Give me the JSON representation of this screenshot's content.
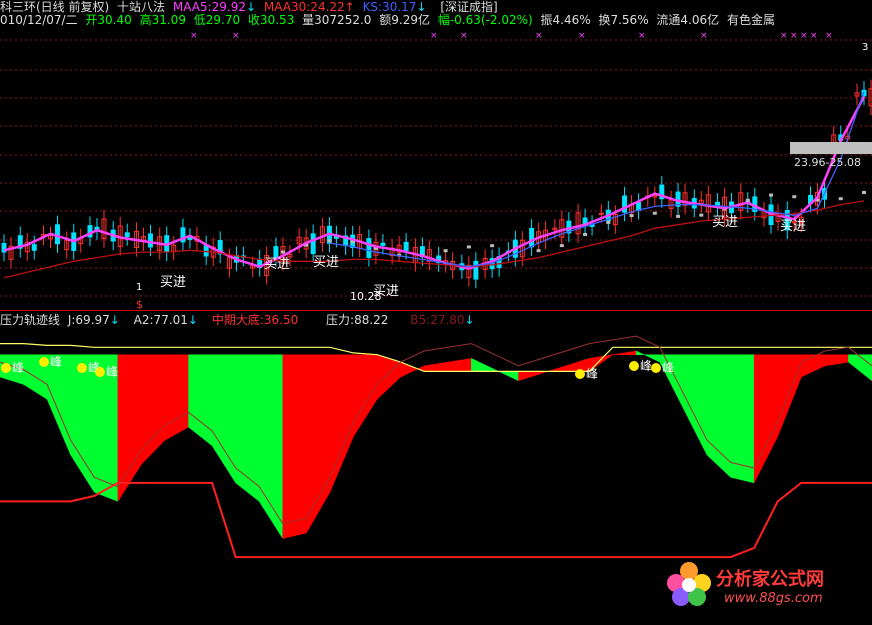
{
  "header": {
    "line1": {
      "title": "科三环(日线 前复权)",
      "method": "十站八法",
      "maa5": {
        "text": "MAA5:29.92",
        "color": "#ff40ff"
      },
      "maa5_arrow": "↓",
      "maa30": {
        "text": "MAA30:24.22",
        "color": "#ff3030"
      },
      "maa30_arrow": "↑",
      "ks": {
        "text": "KS:30.17",
        "color": "#4060ff"
      },
      "ks_arrow": "↓",
      "index": "[深证成指]"
    },
    "line2": {
      "date": "010/12/07/二",
      "open": "开30.40",
      "high": "高31.09",
      "low": "低29.70",
      "close": "收30.53",
      "volume": "量307252.0",
      "amount": "额9.29亿",
      "change": "幅-0.63(-2.02%)",
      "amplitude": "振4.46%",
      "turnover": "换7.56%",
      "float": "流通4.06亿",
      "sector": "有色金属"
    }
  },
  "indicator_header": {
    "name": "压力轨迹线",
    "j": "J:69.97",
    "j_arrow": "↓",
    "a2": "A2:77.01",
    "a2_arrow": "↓",
    "zhongqi": "中期大底:36.50",
    "yali": "压力:88.22",
    "b5": "B5:27.80",
    "b5_arrow": "↓"
  },
  "annotations": {
    "buy": "买进",
    "peak": "峰",
    "range": "23.96-25.08",
    "low_price": "10.28",
    "dollar": "$",
    "s1": "1",
    "s3": "3"
  },
  "watermark": {
    "title": "分析家公式网",
    "url": "www.88gs.com"
  },
  "colors": {
    "up": "#ff3030",
    "down": "#00e0ff",
    "maa5": "#ff40ff",
    "ks": "#4060ff",
    "maa30": "#c01010",
    "grey_series": "#bbbbbb",
    "red_fill": "#ff0000",
    "green_fill": "#00ff30",
    "yellow": "#ffff66",
    "grid": "#8b1a1a"
  },
  "chart_data": [
    {
      "type": "line",
      "panel": "price",
      "series": [
        {
          "name": "MAA5",
          "values": [
            21.5,
            21.8,
            22.4,
            22.0,
            22.6,
            22.2,
            22.0,
            21.8,
            22.3,
            21.6,
            21.0,
            20.6,
            21.2,
            21.9,
            22.4,
            22.1,
            21.7,
            21.5,
            21.2,
            20.8,
            20.5,
            20.9,
            21.6,
            22.2,
            22.6,
            22.9,
            23.4,
            24.0,
            24.6,
            24.2,
            24.0,
            23.8,
            24.1,
            23.5,
            23.2,
            24.4,
            27.5,
            29.9
          ]
        },
        {
          "name": "MAA30",
          "values": [
            20.0,
            20.3,
            20.6,
            20.9,
            21.1,
            21.3,
            21.4,
            21.4,
            21.5,
            21.4,
            21.2,
            21.0,
            20.9,
            20.9,
            20.9,
            21.0,
            21.0,
            20.9,
            20.8,
            20.7,
            20.6,
            20.7,
            20.9,
            21.1,
            21.4,
            21.7,
            22.0,
            22.3,
            22.7,
            22.9,
            23.1,
            23.2,
            23.3,
            23.4,
            23.5,
            23.7,
            24.0,
            24.2
          ]
        },
        {
          "name": "KS",
          "values": [
            null,
            null,
            null,
            null,
            null,
            null,
            null,
            null,
            null,
            null,
            null,
            null,
            null,
            null,
            21.9,
            21.7,
            21.4,
            21.2,
            21.0,
            20.8,
            20.6,
            20.8,
            21.3,
            21.9,
            22.4,
            22.8,
            23.2,
            23.6,
            23.9,
            24.0,
            24.0,
            23.9,
            23.8,
            23.6,
            23.4,
            23.8,
            26.5,
            30.17
          ]
        }
      ],
      "ylim": [
        19,
        33
      ]
    },
    {
      "type": "area",
      "panel": "indicator",
      "series": [
        {
          "name": "压力",
          "values": [
            90,
            90,
            89,
            89,
            88,
            88,
            88,
            88,
            88,
            88,
            88,
            88,
            88,
            88,
            88,
            85,
            84,
            80,
            75,
            75,
            75,
            75,
            75,
            75,
            75,
            75,
            88,
            88,
            88,
            88,
            88,
            88,
            88,
            88,
            88,
            88,
            88,
            88
          ]
        },
        {
          "name": "J",
          "values": [
            72,
            68,
            60,
            30,
            10,
            5,
            25,
            38,
            45,
            35,
            15,
            5,
            -15,
            -12,
            10,
            40,
            60,
            72,
            78,
            80,
            82,
            76,
            70,
            74,
            78,
            82,
            84,
            86,
            80,
            55,
            30,
            18,
            15,
            40,
            72,
            78,
            80,
            69.97
          ]
        },
        {
          "name": "中期大底",
          "values": [
            5,
            5,
            5,
            5,
            8,
            15,
            15,
            15,
            15,
            15,
            -25,
            -25,
            -25,
            -25,
            -25,
            -25,
            -25,
            -25,
            -25,
            -25,
            -25,
            -25,
            -25,
            -25,
            -25,
            -25,
            -25,
            -25,
            -25,
            -25,
            -25,
            -25,
            -20,
            5,
            15,
            15,
            15,
            15
          ]
        }
      ],
      "ylim": [
        -40,
        100
      ]
    }
  ]
}
